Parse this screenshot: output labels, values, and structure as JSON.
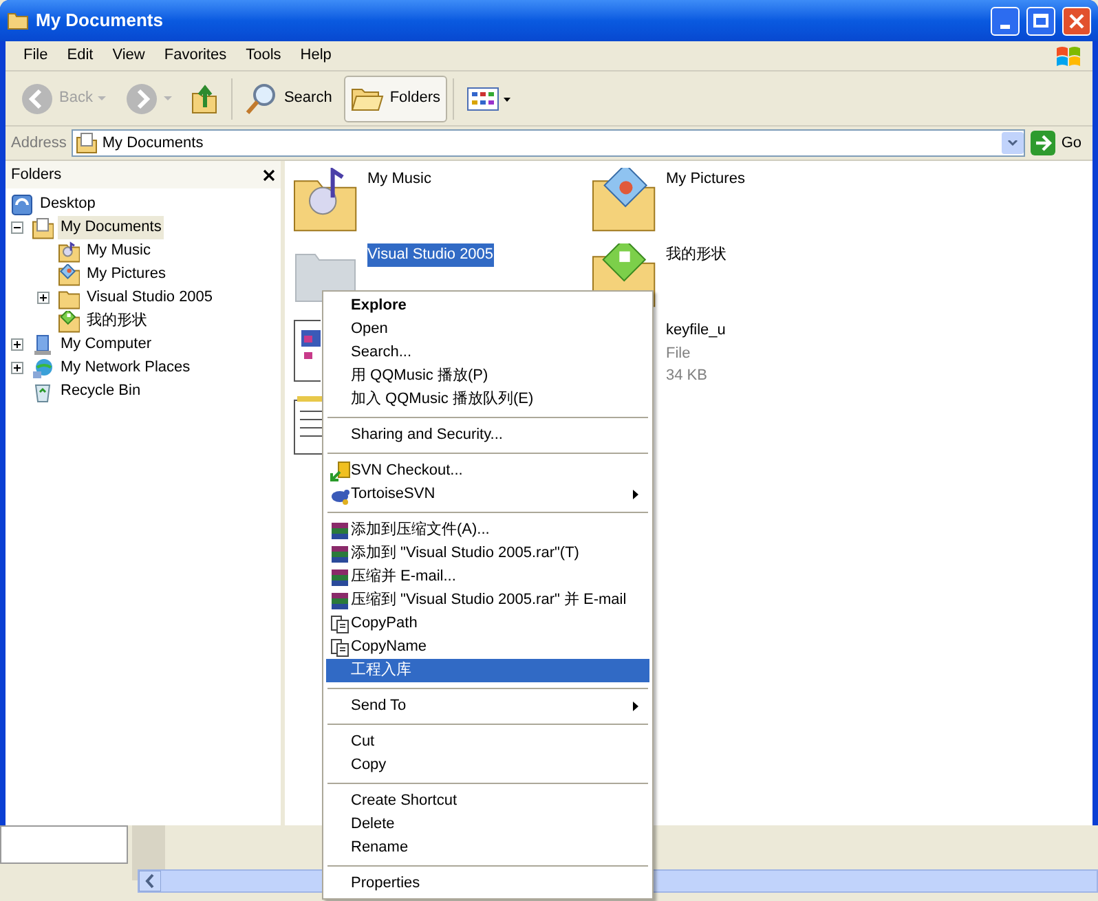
{
  "window": {
    "title": "My Documents"
  },
  "menu_bar": [
    "File",
    "Edit",
    "View",
    "Favorites",
    "Tools",
    "Help"
  ],
  "toolbar": [
    {
      "kind": "back",
      "label": "Back",
      "disabled": true,
      "selected": false
    },
    {
      "kind": "forward",
      "disabled": true,
      "selected": false
    },
    {
      "kind": "up",
      "disabled": false,
      "selected": false
    },
    {
      "kind": "search",
      "label": "Search",
      "disabled": false,
      "selected": false
    },
    {
      "kind": "folders",
      "label": "Folders",
      "disabled": false,
      "selected": true
    },
    {
      "kind": "views",
      "selected": false
    }
  ],
  "address": {
    "label": "Address",
    "value": "My Documents",
    "go": "Go"
  },
  "folders_pane": {
    "title": "Folders",
    "tree": [
      {
        "label": "Desktop",
        "kind": "desktop",
        "selected": false,
        "children": [
          {
            "label": "My Documents",
            "kind": "documents",
            "expanded": true,
            "selected": true,
            "children": [
              {
                "label": "My Music",
                "kind": "music",
                "selected": false
              },
              {
                "label": "My Pictures",
                "kind": "pictures",
                "selected": false
              },
              {
                "label": "Visual Studio 2005",
                "kind": "folder",
                "expanded": false,
                "selected": false
              },
              {
                "label": "我的形状",
                "kind": "shapes",
                "selected": false
              }
            ]
          },
          {
            "label": "My Computer",
            "kind": "computer",
            "expanded": false,
            "selected": false
          },
          {
            "label": "My Network Places",
            "kind": "network",
            "expanded": false,
            "selected": false
          },
          {
            "label": "Recycle Bin",
            "kind": "recycle",
            "selected": false
          }
        ]
      }
    ]
  },
  "files": [
    {
      "name": "My Music",
      "kind": "music",
      "selected": false
    },
    {
      "name": "My Pictures",
      "kind": "pictures",
      "selected": false
    },
    {
      "name": "Visual Studio 2005",
      "kind": "folder",
      "selected": true
    },
    {
      "name": "我的形状",
      "kind": "shapes",
      "selected": false
    },
    {
      "kind": "document",
      "selected": false
    },
    {
      "name": "keyfile_u",
      "kind": "file",
      "type": "File",
      "size": "34 KB",
      "selected": false
    },
    {
      "kind": "notepad",
      "selected": false
    }
  ],
  "context_menu": {
    "items": [
      {
        "kind": "item",
        "label": "Explore",
        "default": true,
        "selected": false
      },
      {
        "kind": "item",
        "label": "Open",
        "selected": false
      },
      {
        "kind": "item",
        "label": "Search...",
        "selected": false
      },
      {
        "kind": "item",
        "label": "用 QQMusic 播放(P)",
        "selected": false
      },
      {
        "kind": "item",
        "label": "加入 QQMusic 播放队列(E)",
        "selected": false
      },
      {
        "kind": "separator"
      },
      {
        "kind": "item",
        "label": "Sharing and Security...",
        "selected": false
      },
      {
        "kind": "separator"
      },
      {
        "kind": "svn-item",
        "label": "SVN Checkout...",
        "selected": false
      },
      {
        "kind": "tortoise-item",
        "label": "TortoiseSVN",
        "submenu": true,
        "selected": false
      },
      {
        "kind": "separator"
      },
      {
        "kind": "archive-item",
        "label": "添加到压缩文件(A)...",
        "selected": false
      },
      {
        "kind": "archive-item",
        "label": "添加到 \"Visual Studio 2005.rar\"(T)",
        "selected": false
      },
      {
        "kind": "archive-item",
        "label": "压缩并 E-mail...",
        "selected": false
      },
      {
        "kind": "archive-item",
        "label": "压缩到 \"Visual Studio 2005.rar\" 并 E-mail",
        "selected": false
      },
      {
        "kind": "copy-item",
        "label": "CopyPath",
        "selected": false
      },
      {
        "kind": "copy-item",
        "label": "CopyName",
        "selected": false
      },
      {
        "kind": "item",
        "label": "工程入库",
        "selected": true
      },
      {
        "kind": "separator"
      },
      {
        "kind": "item",
        "label": "Send To",
        "submenu": true,
        "selected": false
      },
      {
        "kind": "separator"
      },
      {
        "kind": "item",
        "label": "Cut",
        "selected": false
      },
      {
        "kind": "item",
        "label": "Copy",
        "selected": false
      },
      {
        "kind": "separator"
      },
      {
        "kind": "item",
        "label": "Create Shortcut",
        "selected": false
      },
      {
        "kind": "item",
        "label": "Delete",
        "selected": false
      },
      {
        "kind": "item",
        "label": "Rename",
        "selected": false
      },
      {
        "kind": "separator"
      },
      {
        "kind": "item",
        "label": "Properties",
        "selected": false
      }
    ]
  }
}
